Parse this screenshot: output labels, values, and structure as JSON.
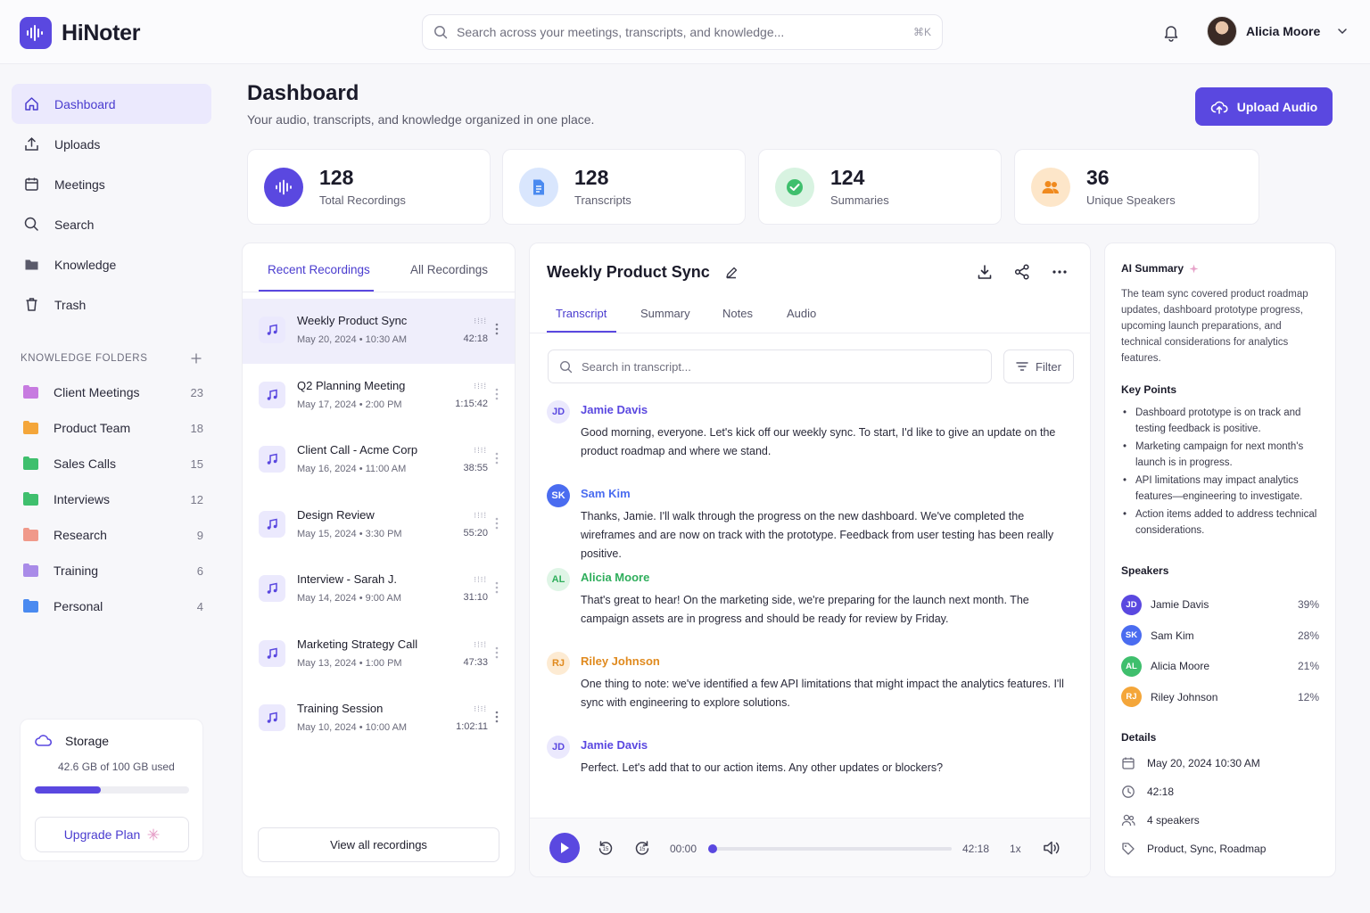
{
  "app": {
    "name": "HiNoter"
  },
  "search": {
    "placeholder": "Search across your meetings, transcripts, and knowledge...",
    "shortcut": "⌘K"
  },
  "user": {
    "name": "Alicia Moore"
  },
  "nav": {
    "items": [
      {
        "label": "Dashboard",
        "icon": "home-icon",
        "active": true
      },
      {
        "label": "Uploads",
        "icon": "upload-icon"
      },
      {
        "label": "Meetings",
        "icon": "calendar-icon"
      },
      {
        "label": "Search",
        "icon": "search-icon"
      },
      {
        "label": "Knowledge",
        "icon": "folder-icon"
      },
      {
        "label": "Trash",
        "icon": "trash-icon"
      }
    ]
  },
  "knowledge_folders": {
    "heading": "KNOWLEDGE FOLDERS",
    "items": [
      {
        "name": "Client Meetings",
        "count": "23",
        "color": "#c77be0"
      },
      {
        "name": "Product Team",
        "count": "18",
        "color": "#f4a63a"
      },
      {
        "name": "Sales Calls",
        "count": "15",
        "color": "#3fbf6d"
      },
      {
        "name": "Interviews",
        "count": "12",
        "color": "#3fbf6d"
      },
      {
        "name": "Research",
        "count": "9",
        "color": "#f0998a"
      },
      {
        "name": "Training",
        "count": "6",
        "color": "#a98be8"
      },
      {
        "name": "Personal",
        "count": "4",
        "color": "#4a8af0"
      }
    ]
  },
  "storage": {
    "title": "Storage",
    "used_text": "42.6 GB of 100 GB used",
    "used_fraction": 0.426,
    "upgrade_label": "Upgrade Plan"
  },
  "page": {
    "title": "Dashboard",
    "subtitle": "Your audio, transcripts, and knowledge organized in one place.",
    "upload_label": "Upload Audio"
  },
  "stats": [
    {
      "value": "128",
      "label": "Total Recordings",
      "icon": "waveform-icon",
      "color": "#5a48e0"
    },
    {
      "value": "128",
      "label": "Transcripts",
      "icon": "document-icon",
      "color": "#4a8af0"
    },
    {
      "value": "124",
      "label": "Summaries",
      "icon": "check-icon",
      "color": "#3fbf6d"
    },
    {
      "value": "36",
      "label": "Unique Speakers",
      "icon": "users-icon",
      "color": "#f4a63a"
    }
  ],
  "recordings": {
    "tabs": [
      "Recent Recordings",
      "All Recordings"
    ],
    "items": [
      {
        "title": "Weekly Product Sync",
        "date": "May 20, 2024 • 10:30 AM",
        "duration": "42:18"
      },
      {
        "title": "Q2 Planning Meeting",
        "date": "May 17, 2024 • 2:00 PM",
        "duration": "1:15:42"
      },
      {
        "title": "Client Call - Acme Corp",
        "date": "May 16, 2024 • 11:00 AM",
        "duration": "38:55"
      },
      {
        "title": "Design Review",
        "date": "May 15, 2024 • 3:30 PM",
        "duration": "55:20"
      },
      {
        "title": "Interview - Sarah J.",
        "date": "May 14, 2024 • 9:00 AM",
        "duration": "31:10"
      },
      {
        "title": "Marketing Strategy Call",
        "date": "May 13, 2024 • 1:00 PM",
        "duration": "47:33"
      },
      {
        "title": "Training Session",
        "date": "May 10, 2024 • 10:00 AM",
        "duration": "1:02:11"
      }
    ],
    "view_all_label": "View all recordings"
  },
  "transcript": {
    "title": "Weekly Product Sync",
    "tabs": [
      "Transcript",
      "Summary",
      "Notes",
      "Audio"
    ],
    "search_placeholder": "Search in transcript...",
    "filter_label": "Filter",
    "entries": [
      {
        "initials": "JD",
        "speaker": "Jamie Davis",
        "color": "#5a48e0",
        "bg": "#ebe9fd",
        "text": "Good morning, everyone. Let's kick off our weekly sync. To start, I'd like to give an update on the product roadmap and where we stand."
      },
      {
        "initials": "SK",
        "speaker": "Sam Kim",
        "color": "#4a6cf0",
        "bg": "#4a6cf0",
        "text": "Thanks, Jamie. I'll walk through the progress on the new dashboard. We've completed the wireframes and are now on track with the prototype. Feedback from user testing has been really positive."
      },
      {
        "initials": "AL",
        "speaker": "Alicia Moore",
        "color": "#2fae5c",
        "bg": "#dff5e6",
        "text": "That's great to hear! On the marketing side, we're preparing for the launch next month. The campaign assets are in progress and should be ready for review by Friday."
      },
      {
        "initials": "RJ",
        "speaker": "Riley Johnson",
        "color": "#e08a1e",
        "bg": "#fdebd3",
        "text": "One thing to note: we've identified a few API limitations that might impact the analytics features. I'll sync with engineering to explore solutions."
      },
      {
        "initials": "JD",
        "speaker": "Jamie Davis",
        "color": "#5a48e0",
        "bg": "#ebe9fd",
        "text": "Perfect. Let's add that to our action items. Any other updates or blockers?"
      }
    ],
    "player": {
      "current": "00:00",
      "total": "42:18",
      "speed": "1x"
    }
  },
  "ai": {
    "heading": "AI Summary",
    "summary": "The team sync covered product roadmap updates, dashboard prototype progress, upcoming launch preparations, and technical considerations for analytics features.",
    "key_points_heading": "Key Points",
    "key_points": [
      "Dashboard prototype is on track and testing feedback is positive.",
      "Marketing campaign for next month's launch is in progress.",
      "API limitations may impact analytics features—engineering to investigate.",
      "Action items added to address technical considerations."
    ],
    "speakers_heading": "Speakers",
    "speakers": [
      {
        "initials": "JD",
        "name": "Jamie Davis",
        "pct": "39%",
        "color": "#5a48e0"
      },
      {
        "initials": "SK",
        "name": "Sam Kim",
        "pct": "28%",
        "color": "#4a6cf0"
      },
      {
        "initials": "AL",
        "name": "Alicia Moore",
        "pct": "21%",
        "color": "#3fbf6d"
      },
      {
        "initials": "RJ",
        "name": "Riley Johnson",
        "pct": "12%",
        "color": "#f4a63a"
      }
    ],
    "details_heading": "Details",
    "details": [
      {
        "icon": "calendar-icon",
        "text": "May 20, 2024 10:30 AM"
      },
      {
        "icon": "clock-icon",
        "text": "42:18"
      },
      {
        "icon": "users-icon",
        "text": "4 speakers"
      },
      {
        "icon": "tag-icon",
        "text": "Product, Sync, Roadmap"
      }
    ]
  }
}
